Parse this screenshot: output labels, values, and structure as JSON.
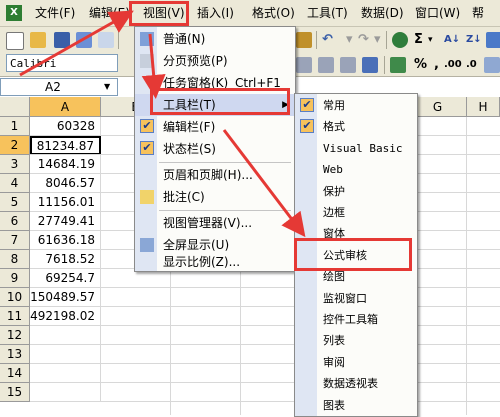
{
  "menubar": {
    "app_icon": "excel-icon",
    "items": [
      "文件(F)",
      "编辑(E)",
      "视图(V)",
      "插入(I)",
      "格式(O)",
      "工具(T)",
      "数据(D)",
      "窗口(W)",
      "帮"
    ]
  },
  "toolbar": {
    "font_name": "Calibri",
    "sigma": "Σ",
    "percent": "%",
    "comma": ","
  },
  "formula_bar": {
    "name_box": "A2"
  },
  "sheet": {
    "columns": [
      "A",
      "B",
      "C",
      "D",
      "E",
      "F",
      "G",
      "H"
    ],
    "rows": [
      "1",
      "2",
      "3",
      "4",
      "5",
      "6",
      "7",
      "8",
      "9",
      "10",
      "11",
      "12",
      "13",
      "14",
      "15"
    ],
    "column_a_values": [
      "60328",
      "81234.87",
      "14684.19",
      "8046.57",
      "11156.01",
      "27749.41",
      "61636.18",
      "7618.52",
      "69254.7",
      "150489.57",
      "492198.02"
    ],
    "active_cell": "A2"
  },
  "view_menu": {
    "title": "视图(V)",
    "items": [
      {
        "label": "普通(N)",
        "icon": "normal-view-icon"
      },
      {
        "label": "分页预览(P)",
        "icon": "page-break-preview-icon"
      },
      {
        "label": "任务窗格(K)",
        "shortcut": "Ctrl+F1"
      },
      {
        "label": "工具栏(T)",
        "submenu": true
      },
      {
        "label": "编辑栏(F)",
        "checked": true
      },
      {
        "label": "状态栏(S)",
        "checked": true
      },
      {
        "label": "页眉和页脚(H)..."
      },
      {
        "label": "批注(C)",
        "icon": "comment-icon"
      },
      {
        "label": "视图管理器(V)..."
      },
      {
        "label": "全屏显示(U)",
        "icon": "full-screen-icon"
      },
      {
        "label": "显示比例(Z)..."
      }
    ]
  },
  "toolbars_submenu": {
    "items": [
      {
        "label": "常用",
        "checked": true
      },
      {
        "label": "格式",
        "checked": true
      },
      {
        "label": "Visual Basic"
      },
      {
        "label": "Web"
      },
      {
        "label": "保护"
      },
      {
        "label": "边框"
      },
      {
        "label": "窗体"
      },
      {
        "label": "公式审核"
      },
      {
        "label": "绘图"
      },
      {
        "label": "监视窗口"
      },
      {
        "label": "控件工具箱"
      },
      {
        "label": "列表"
      },
      {
        "label": "审阅"
      },
      {
        "label": "数据透视表"
      },
      {
        "label": "图表"
      }
    ]
  },
  "colors": {
    "annotation": "#e53935",
    "checked_bg": "#f7c25c",
    "menu_stripe": "#dfe6f3",
    "chrome": "#ece9d8"
  }
}
